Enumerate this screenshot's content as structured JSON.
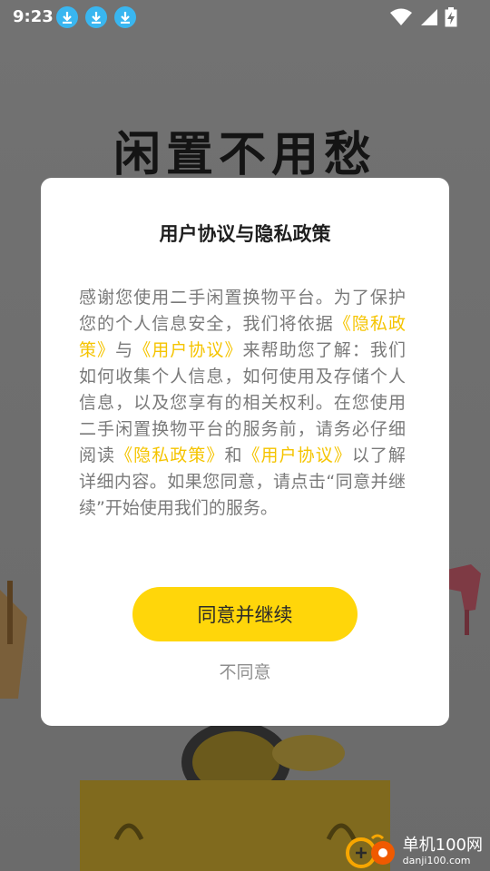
{
  "status_bar": {
    "time": "9:23",
    "download_icons": [
      "download-icon",
      "download-icon",
      "download-icon"
    ],
    "right_icons": [
      "wifi-icon",
      "signal-icon",
      "battery-charging-icon"
    ]
  },
  "background": {
    "headline": "闲置不用愁"
  },
  "dialog": {
    "title": "用户协议与隐私政策",
    "body": {
      "p1": "感谢您使用二手闲置换物平台。为了保护您的个人信息安全，我们将依据",
      "link_privacy": "《隐私政策》",
      "p2": "与",
      "link_user": "《用户协议》",
      "p3": "来帮助您了解：我们如何收集个人信息，如何使用及存储个人信息，以及您享有的相关权利。在您使用二手闲置换物平台的服务前，请务必仔细阅读",
      "link_privacy_2": "《隐私政策》",
      "p4": "和",
      "link_user_2": "《用户协议》",
      "p5": "以了解详细内容。如果您同意，请点击“同意并继续”开始使用我们的服务。"
    },
    "agree_label": "同意并继续",
    "decline_label": "不同意"
  },
  "watermark": {
    "site_name": "单机100网",
    "url": "danji100.com"
  },
  "colors": {
    "accent": "#ffd60a",
    "link": "#f5c400",
    "overlay": "#6e6e6e"
  }
}
